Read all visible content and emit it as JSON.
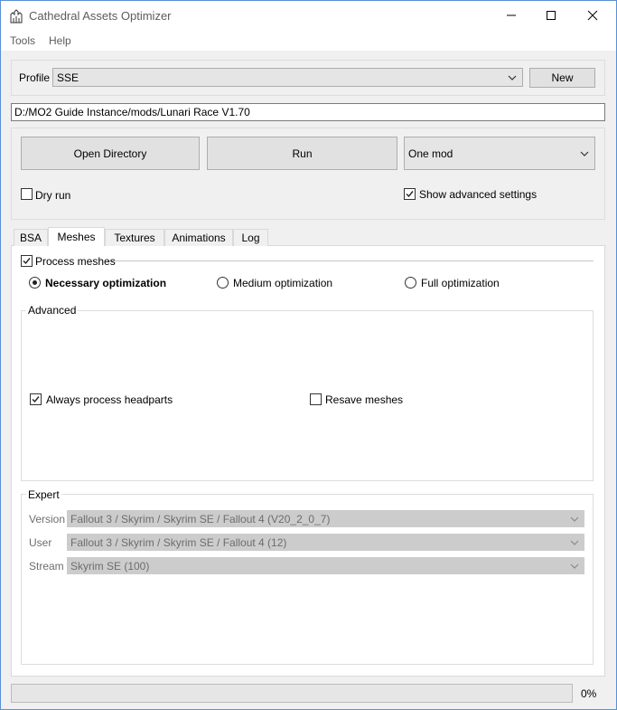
{
  "window": {
    "title": "Cathedral Assets Optimizer",
    "icons": {
      "app": "cathedral-icon",
      "minimize": "minimize-icon",
      "maximize": "maximize-icon",
      "close": "close-icon"
    }
  },
  "menu": {
    "tools": "Tools",
    "help": "Help"
  },
  "profile": {
    "label": "Profile",
    "value": "SSE",
    "new_button": "New"
  },
  "path": {
    "value": "D:/MO2 Guide Instance/mods/Lunari Race V1.70"
  },
  "actions": {
    "open_directory": "Open Directory",
    "run": "Run",
    "mode": "One mod",
    "dry_run": {
      "label": "Dry run",
      "checked": false
    },
    "show_advanced": {
      "label": "Show advanced settings",
      "checked": true
    }
  },
  "tabs": [
    {
      "label": "BSA"
    },
    {
      "label": "Meshes"
    },
    {
      "label": "Textures"
    },
    {
      "label": "Animations"
    },
    {
      "label": "Log"
    }
  ],
  "meshes": {
    "process_meshes": {
      "label": "Process meshes",
      "checked": true
    },
    "optimization": {
      "necessary": "Necessary optimization",
      "medium": "Medium optimization",
      "full": "Full optimization",
      "selected": "necessary"
    },
    "advanced": {
      "title": "Advanced",
      "always_process_headparts": {
        "label": "Always process headparts",
        "checked": true
      },
      "resave_meshes": {
        "label": "Resave meshes",
        "checked": false
      }
    },
    "expert": {
      "title": "Expert",
      "version": {
        "label": "Version",
        "value": "Fallout 3 / Skyrim / Skyrim SE / Fallout 4 (V20_2_0_7)"
      },
      "user": {
        "label": "User",
        "value": "Fallout 3 / Skyrim / Skyrim SE / Fallout 4 (12)"
      },
      "stream": {
        "label": "Stream",
        "value": "Skyrim SE (100)"
      }
    }
  },
  "progress": {
    "value": 0,
    "text": "0%"
  },
  "colors": {
    "window_border": "#5a8fd6",
    "background": "#f0f0f0",
    "disabled_text": "#6d6d6d"
  }
}
